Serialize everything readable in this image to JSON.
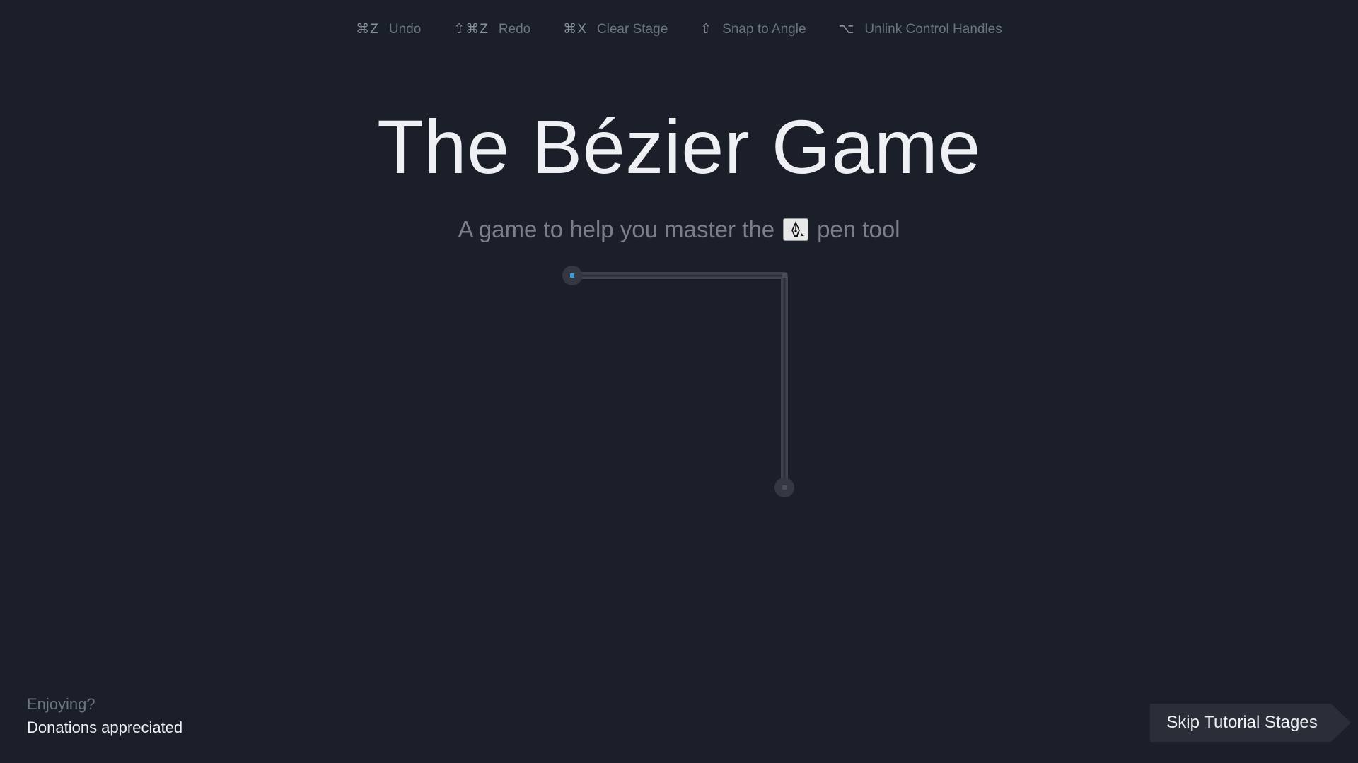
{
  "shortcuts": [
    {
      "keys": "⌘Z",
      "label": "Undo"
    },
    {
      "keys": "⇧⌘Z",
      "label": "Redo"
    },
    {
      "keys": "⌘X",
      "label": "Clear Stage"
    },
    {
      "keys": "⇧",
      "label": "Snap to Angle"
    },
    {
      "keys": "⌥",
      "label": "Unlink Control Handles"
    }
  ],
  "title": "The Bézier Game",
  "subtitle": {
    "before": "A game to help you master the",
    "icon": "pen-tool-icon",
    "after": "pen tool"
  },
  "stage": {
    "path_color": "#3d424d",
    "point_color": "#333842",
    "start_marker_color": "#3aa0d8"
  },
  "donate": {
    "question": "Enjoying?",
    "link": "Donations appreciated"
  },
  "skip_button": {
    "label": "Skip Tutorial Stages",
    "color": "#2a2e38"
  },
  "colors": {
    "background": "#1b1f2a",
    "title": "#eef0f4",
    "muted": "#6d7380"
  }
}
